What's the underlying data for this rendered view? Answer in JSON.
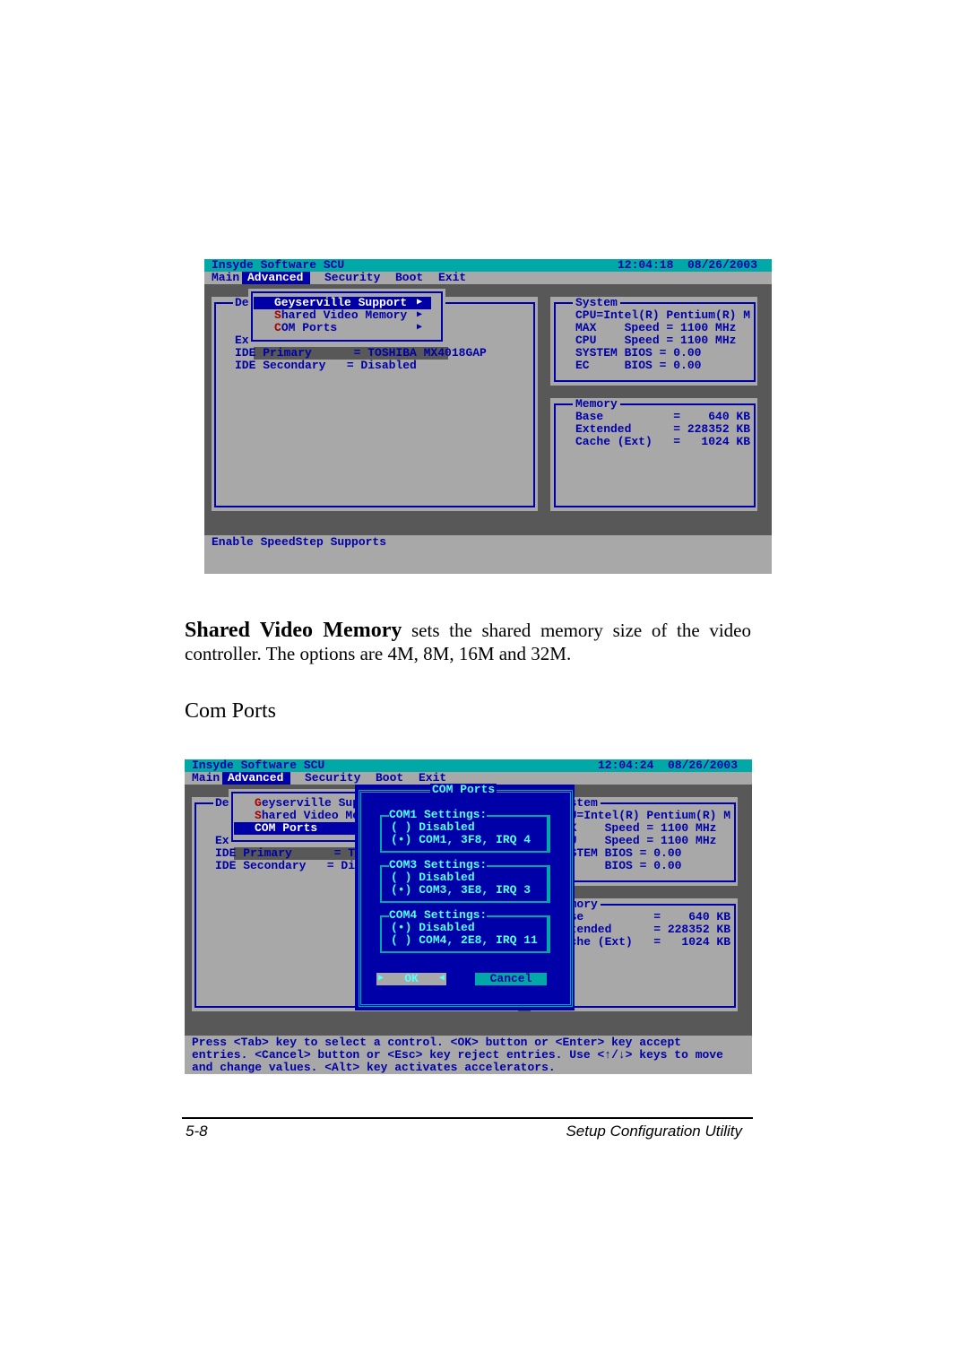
{
  "screens": [
    {
      "title": "Insyde Software SCU",
      "clock": "12:04:18  08/26/2003",
      "menu": [
        "Main",
        "Advanced",
        "Security",
        "Boot",
        "Exit"
      ],
      "active_menu_index": 1,
      "left_rows": [
        "De",
        "Ex",
        "IDE Primary      = TOSHIBA MX4018GAP",
        "IDE Secondary   = Disabled"
      ],
      "popup": {
        "items": [
          "Geyserville Support",
          "Shared Video Memory",
          "COM Ports"
        ],
        "selected": 0
      },
      "system_panel": [
        "System",
        "CPU=Intel(R) Pentium(R) M",
        "MAX    Speed = 1100 MHz",
        "CPU    Speed = 1100 MHz",
        "SYSTEM BIOS = 0.00",
        "EC     BIOS = 0.00"
      ],
      "memory_panel": [
        "Memory",
        "Base          =    640 KB",
        "Extended      = 228352 KB",
        "Cache (Ext)   =   1024 KB"
      ],
      "status_lines": [
        "Enable SpeedStep Supports"
      ]
    },
    {
      "title": "Insyde Software SCU",
      "clock": "12:04:24  08/26/2003",
      "menu": [
        "Main",
        "Advanced",
        "Security",
        "Boot",
        "Exit"
      ],
      "active_menu_index": 1,
      "left_rows": [
        "De",
        "Ex",
        "IDE Primary      = TOSHIBA MX4018GAP",
        "IDE Secondary   = Disabled"
      ],
      "popup": {
        "items": [
          "Geyserville Support",
          "Shared Video Memory",
          "COM Ports"
        ],
        "selected": 2
      },
      "system_panel": [
        "System",
        "CPU=Intel(R) Pentium(R) M",
        "MAX    Speed = 1100 MHz",
        "CPU    Speed = 1100 MHz",
        "SYSTEM BIOS = 0.00",
        "EC     BIOS = 0.00"
      ],
      "memory_panel": [
        "Memory",
        "Base          =    640 KB",
        "Extended      = 228352 KB",
        "Cache (Ext)   =   1024 KB"
      ],
      "status_lines": [
        "Press <Tab> key to select a control. <OK> button or <Enter> key accept",
        "entries. <Cancel> button or <Esc> key reject entries. Use <↑/↓> keys to move",
        "and change values. <Alt> key activates accelerators."
      ],
      "dialog": {
        "title": "COM Ports",
        "groups": [
          {
            "title": "COM1 Settings:",
            "options": [
              "Disabled",
              "COM1, 3F8, IRQ 4"
            ],
            "selected": 1
          },
          {
            "title": "COM3 Settings:",
            "options": [
              "Disabled",
              "COM3, 3E8, IRQ 3"
            ],
            "selected": 1
          },
          {
            "title": "COM4 Settings:",
            "options": [
              "Disabled",
              "COM4, 2E8, IRQ 11"
            ],
            "selected": 0
          }
        ],
        "ok_label": "OK",
        "cancel_label": "Cancel",
        "focused_button": "OK"
      }
    }
  ],
  "text": {
    "para_bold": "Shared Video Memory",
    "para_rest": " sets the shared memory size of the video controller. The options are 4M, 8M, 16M and 32M.",
    "heading": "Com Ports"
  },
  "footer": {
    "page": "5-8",
    "title": "Setup Configuration Utility"
  },
  "colors": {
    "teal": "#00a8a8",
    "gray": "#a8a8a8",
    "dark_gray": "#585858",
    "blue": "#0000a8",
    "hotkey_red": "#a80000"
  }
}
